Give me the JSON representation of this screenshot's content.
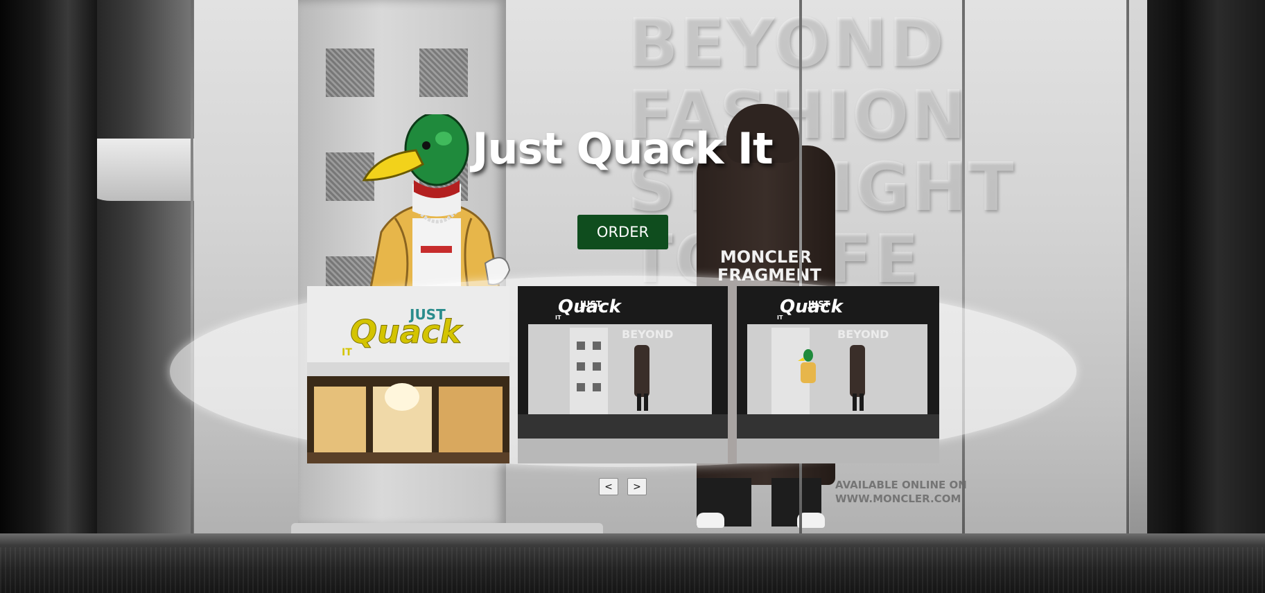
{
  "hero": {
    "title": "Just Quack It"
  },
  "order_button": {
    "label": "ORDER"
  },
  "carousel": {
    "prev_label": "<",
    "next_label": ">",
    "slides": [
      {
        "logo_small": "JUST",
        "logo_main": "Quack",
        "logo_it": "IT"
      },
      {
        "logo_small": "JUST",
        "logo_main": "Quack",
        "logo_it": "IT"
      },
      {
        "logo_small": "JUST",
        "logo_main": "Quack",
        "logo_it": "IT"
      }
    ]
  },
  "background": {
    "wall_text": "BEYOND\nFASHION\nSTRAIGHT\nTO LIFE",
    "jacket_print": "MONCLER\nFRAGMENT",
    "window_notice": "AVAILABLE ONLINE ON\nWWW.MONCLER.COM"
  },
  "colors": {
    "order_button_bg": "#0f4d1e",
    "title_text": "#ffffff",
    "logo_yellow": "#d4c400",
    "logo_teal": "#2a8c8c"
  }
}
